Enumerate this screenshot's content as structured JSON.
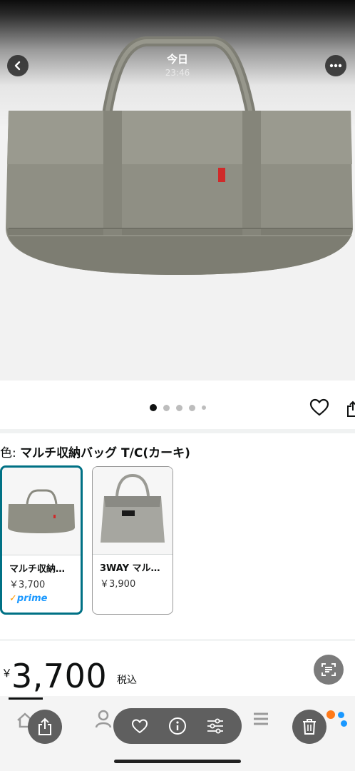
{
  "viewer": {
    "title": "今日",
    "time": "23:46",
    "back_icon": "chevron-left-icon",
    "more_icon": "ellipsis-icon"
  },
  "gallery": {
    "image_count": 5,
    "active_index": 0
  },
  "color": {
    "label": "色:",
    "value": "マルチ収納バッグ T/C(カーキ)"
  },
  "variants": [
    {
      "name": "マルチ収納…",
      "price": "￥3,700",
      "prime": "prime",
      "selected": true
    },
    {
      "name": "3WAY マル…",
      "price": "￥3,900",
      "selected": false
    }
  ],
  "price": {
    "symbol": "￥",
    "amount": "3,700",
    "tax": "税込"
  },
  "toolbar": {
    "icons": [
      "share-icon",
      "heart-icon",
      "info-icon",
      "adjust-icon",
      "trash-icon"
    ]
  },
  "colors": {
    "accent": "#007185",
    "prime_blue": "#1a98ff",
    "bag_khaki": "#8f8f84"
  }
}
